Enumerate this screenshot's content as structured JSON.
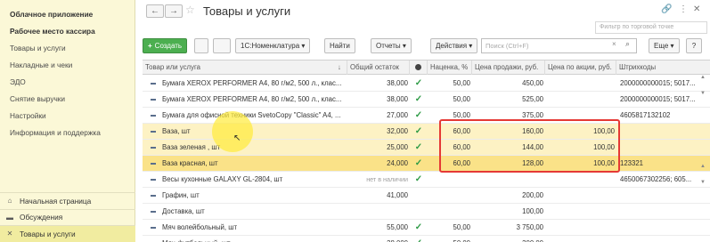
{
  "sidebar": {
    "items": [
      {
        "label": "Облачное приложение",
        "bold": true
      },
      {
        "label": "Рабочее место кассира",
        "bold": true
      },
      {
        "label": "Товары и услуги",
        "bold": false
      },
      {
        "label": "Накладные и чеки",
        "bold": false
      },
      {
        "label": "ЭДО",
        "bold": false
      },
      {
        "label": "Снятие выручки",
        "bold": false
      },
      {
        "label": "Настройки",
        "bold": false
      },
      {
        "label": "Информация и поддержка",
        "bold": false
      }
    ],
    "bottom": [
      {
        "label": "Начальная страница",
        "icon": "home-icon",
        "glyph": "⌂"
      },
      {
        "label": "Обсуждения",
        "icon": "chat-icon",
        "glyph": "▬"
      },
      {
        "label": "Товары и услуги",
        "icon": "close-icon",
        "glyph": "✕",
        "active": true
      }
    ]
  },
  "header": {
    "title": "Товары и услуги",
    "back_glyph": "←",
    "forward_glyph": "→",
    "star_glyph": "☆",
    "link_glyph": "🔗",
    "menu_glyph": "⋮",
    "close_glyph": "✕",
    "filter_placeholder": "Фильтр по торговой точке"
  },
  "toolbar": {
    "create_label": "Создать",
    "plus_glyph": "+",
    "nomenclature_label": "1С:Номенклатура",
    "find_label": "Найти",
    "reports_label": "Отчеты",
    "actions_label": "Действия",
    "search_placeholder": "Поиск (Ctrl+F)",
    "more_label": "Еще",
    "help_glyph": "?",
    "dropdown_glyph": "▾",
    "clear_glyph": "×",
    "search_glyph": "⌕"
  },
  "table": {
    "columns": {
      "name": "Товар или услуга",
      "sort_glyph": "↓",
      "stock": "Общий остаток",
      "markup": "Наценка, %",
      "price": "Цена продажи, руб.",
      "promo": "Цена по акции, руб.",
      "barcode": "Штрихкоды"
    },
    "rows": [
      {
        "name": "Бумага XEROX PERFORMER A4, 80 г/м2, 500 л., клас...",
        "stock": "38,000",
        "check": "✓",
        "markup": "50,00",
        "price": "450,00",
        "promo": "",
        "barcode": "2000000000015; 5017...",
        "style": ""
      },
      {
        "name": "Бумага XEROX PERFORMER A4, 80 г/м2, 500 л., клас...",
        "stock": "38,000",
        "check": "✓",
        "markup": "50,00",
        "price": "525,00",
        "promo": "",
        "barcode": "2000000000015; 5017...",
        "style": ""
      },
      {
        "name": "Бумага для офисной техники SvetoCopy \"Classic\" A4, ...",
        "stock": "27,000",
        "check": "✓",
        "markup": "50,00",
        "price": "375,00",
        "promo": "",
        "barcode": "4605817132102",
        "style": ""
      },
      {
        "name": "Ваза, шт",
        "stock": "32,000",
        "check": "✓",
        "markup": "60,00",
        "price": "160,00",
        "promo": "100,00",
        "barcode": "",
        "style": "hl"
      },
      {
        "name": "Ваза зеленая , шт",
        "stock": "25,000",
        "check": "✓",
        "markup": "60,00",
        "price": "144,00",
        "promo": "100,00",
        "barcode": "",
        "style": "hl"
      },
      {
        "name": "Ваза красная, шт",
        "stock": "24,000",
        "check": "✓",
        "markup": "60,00",
        "price": "128,00",
        "promo": "100,00",
        "barcode": "123321",
        "style": "sel"
      },
      {
        "name": "Весы кухонные GALAXY GL-2804, шт",
        "stock": "нет в наличии",
        "check": "✓",
        "markup": "",
        "price": "",
        "promo": "",
        "barcode": "4650067302256; 605...",
        "style": ""
      },
      {
        "name": "Графин, шт",
        "stock": "41,000",
        "check": "",
        "markup": "",
        "price": "200,00",
        "promo": "",
        "barcode": "",
        "style": ""
      },
      {
        "name": "Доставка, шт",
        "stock": "",
        "check": "",
        "markup": "",
        "price": "100,00",
        "promo": "",
        "barcode": "",
        "style": ""
      },
      {
        "name": "Мяч волейбольный, шт",
        "stock": "55,000",
        "check": "✓",
        "markup": "50,00",
        "price": "3 750,00",
        "promo": "",
        "barcode": "",
        "style": ""
      },
      {
        "name": "Мяч футбольный, шт",
        "stock": "38,000",
        "check": "✓",
        "markup": "50,00",
        "price": "300,00",
        "promo": "",
        "barcode": "",
        "style": ""
      }
    ]
  },
  "colors": {
    "sidebar_bg": "#fbf8d7",
    "highlight_row": "#fdf2c4",
    "selected_row": "#fae288",
    "create_button": "#4caf50",
    "check": "#2e9b46",
    "annotation_box": "#e53935"
  }
}
